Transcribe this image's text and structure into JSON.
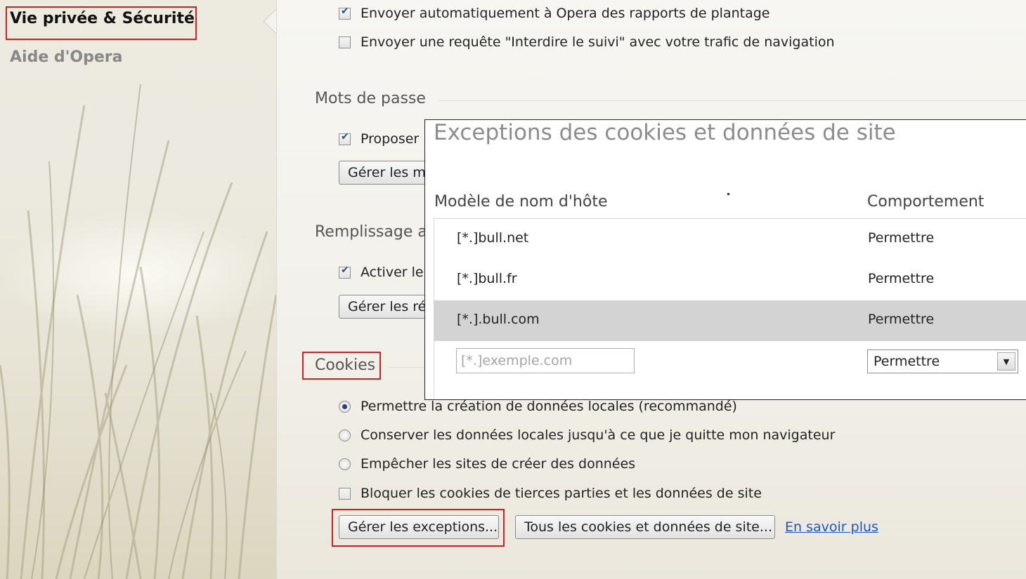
{
  "sidebar": {
    "items": [
      {
        "label": "Vie privée & Sécurité"
      },
      {
        "label": "Aide d'Opera"
      }
    ]
  },
  "privacy": {
    "crash_reports_label": "Envoyer automatiquement à Opera des rapports de plantage",
    "do_not_track_label": "Envoyer une requête \"Interdire le suivi\" avec votre trafic de navigation"
  },
  "passwords": {
    "title": "Mots de passe",
    "offer_save_label": "Proposer",
    "manage_button": "Gérer les m"
  },
  "autofill": {
    "title": "Remplissage a",
    "enable_label": "Activer le",
    "manage_button": "Gérer les ré"
  },
  "cookies": {
    "title": "Cookies",
    "options": [
      {
        "label": "Permettre la création de données locales (recommandé)"
      },
      {
        "label": "Conserver les données locales jusqu'à ce que je quitte mon navigateur"
      },
      {
        "label": "Empêcher les sites de créer des données"
      }
    ],
    "block_third_party_label": "Bloquer les cookies de tierces parties et les données de site",
    "manage_exceptions_button": "Gérer les exceptions...",
    "all_cookies_button": "Tous les cookies et données de site...",
    "learn_more_link": "En savoir plus"
  },
  "dialog": {
    "title": "Exceptions des cookies et données de site",
    "columns": {
      "pattern": "Modèle de nom d'hôte",
      "behavior": "Comportement"
    },
    "rows": [
      {
        "pattern": "[*.]bull.net",
        "behavior": "Permettre"
      },
      {
        "pattern": "[*.]bull.fr",
        "behavior": "Permettre"
      },
      {
        "pattern": "[*.].bull.com",
        "behavior": "Permettre"
      }
    ],
    "new_pattern_placeholder": "[*.]exemple.com",
    "new_behavior_value": "Permettre"
  },
  "colors": {
    "highlight_box": "#d81e1e",
    "selected_row": "#d3d3d3",
    "link": "#1a57c6"
  }
}
